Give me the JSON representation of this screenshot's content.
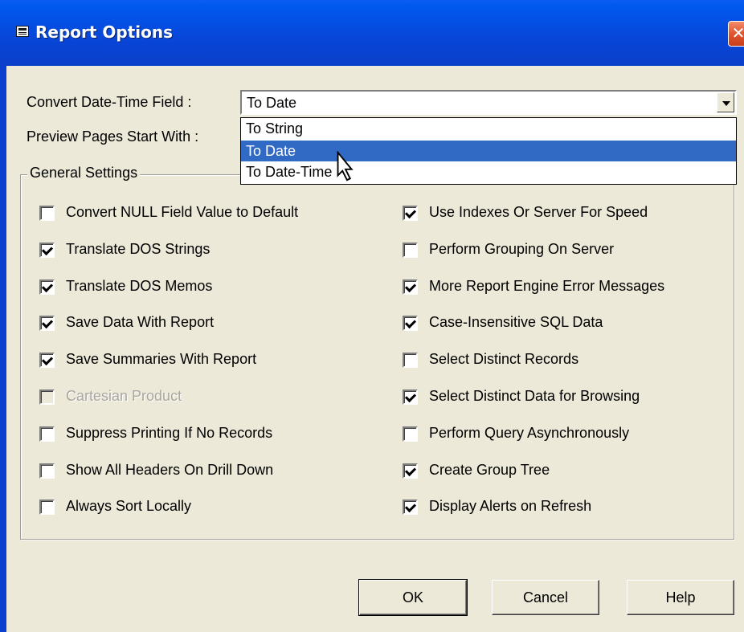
{
  "window": {
    "title": "Report Options",
    "close_glyph": "✕"
  },
  "fields": {
    "convert_label": "Convert Date-Time Field :",
    "convert_value": "To Date",
    "preview_label": "Preview Pages Start With :"
  },
  "dropdown": {
    "options": [
      "To String",
      "To Date",
      "To Date-Time"
    ],
    "selected": "To Date"
  },
  "group": {
    "title": "General Settings"
  },
  "left_checks": [
    {
      "label": "Convert NULL Field Value to Default",
      "checked": false,
      "enabled": true
    },
    {
      "label": "Translate DOS Strings",
      "checked": true,
      "enabled": true
    },
    {
      "label": "Translate DOS Memos",
      "checked": true,
      "enabled": true
    },
    {
      "label": "Save Data With Report",
      "checked": true,
      "enabled": true
    },
    {
      "label": "Save Summaries With Report",
      "checked": true,
      "enabled": true
    },
    {
      "label": "Cartesian Product",
      "checked": false,
      "enabled": false
    },
    {
      "label": "Suppress Printing If No Records",
      "checked": false,
      "enabled": true
    },
    {
      "label": "Show All Headers On Drill Down",
      "checked": false,
      "enabled": true
    },
    {
      "label": "Always Sort Locally",
      "checked": false,
      "enabled": true
    }
  ],
  "right_checks": [
    {
      "label": "Use Indexes Or Server For Speed",
      "checked": true,
      "enabled": true
    },
    {
      "label": "Perform Grouping On Server",
      "checked": false,
      "enabled": true
    },
    {
      "label": "More Report Engine Error Messages",
      "checked": true,
      "enabled": true
    },
    {
      "label": "Case-Insensitive SQL Data",
      "checked": true,
      "enabled": true
    },
    {
      "label": "Select Distinct Records",
      "checked": false,
      "enabled": true
    },
    {
      "label": "Select Distinct Data for Browsing",
      "checked": true,
      "enabled": true
    },
    {
      "label": "Perform Query Asynchronously",
      "checked": false,
      "enabled": true
    },
    {
      "label": "Create Group Tree",
      "checked": true,
      "enabled": true
    },
    {
      "label": "Display Alerts on Refresh",
      "checked": true,
      "enabled": true
    }
  ],
  "buttons": {
    "ok": "OK",
    "cancel": "Cancel",
    "help": "Help"
  },
  "colors": {
    "title_bar": "#0a4fe0",
    "dialog_bg": "#ece9d8",
    "selection": "#316ac5",
    "close_button": "#e0552f"
  },
  "icons": {
    "title": "dialog-icon",
    "close": "close-icon",
    "combo_arrow": "chevron-down-icon",
    "cursor": "mouse-pointer-icon"
  }
}
